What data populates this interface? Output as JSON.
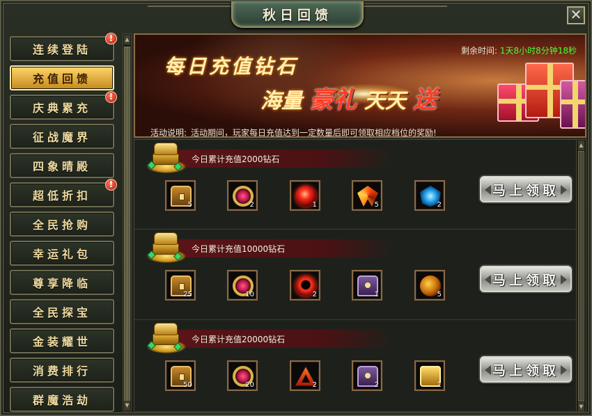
{
  "window": {
    "title": "秋日回馈",
    "close_icon": "close-icon"
  },
  "sidebar": {
    "items": [
      {
        "label": "连续登陆",
        "alert": "!"
      },
      {
        "label": "充值回馈",
        "active": true
      },
      {
        "label": "庆典累充",
        "alert": "!"
      },
      {
        "label": "征战魔界"
      },
      {
        "label": "四象晴殿"
      },
      {
        "label": "超低折扣",
        "alert": "!"
      },
      {
        "label": "全民抢购"
      },
      {
        "label": "幸运礼包"
      },
      {
        "label": "尊享降临"
      },
      {
        "label": "全民探宝"
      },
      {
        "label": "金装耀世"
      },
      {
        "label": "消费排行"
      },
      {
        "label": "群魔浩劫"
      }
    ]
  },
  "banner": {
    "line1": "每日充值钻石",
    "line2_a": "海量",
    "line2_b": "豪礼",
    "line2_c": "天天",
    "line2_d": "送",
    "remain_label": "剩余时间:",
    "remain_value": "1天8小时8分钟18秒",
    "desc_label": "活动说明:",
    "desc_text": "活动期间，玩家每日充值达到一定数量后即可领取相应档位的奖励!"
  },
  "tiers": [
    {
      "title": "今日累计充值2000钻石",
      "button": "马上领取",
      "items": [
        {
          "icon": "chest-icon",
          "qty": "5"
        },
        {
          "icon": "ruby-ring-icon",
          "qty": "2"
        },
        {
          "icon": "fire-orb-icon",
          "qty": "1"
        },
        {
          "icon": "phoenix-wing-icon",
          "qty": "5"
        },
        {
          "icon": "sapphire-icon",
          "qty": "2"
        }
      ]
    },
    {
      "title": "今日累计充值10000钻石",
      "button": "马上领取",
      "items": [
        {
          "icon": "chest-icon",
          "qty": "25"
        },
        {
          "icon": "ruby-ring-icon",
          "qty": "10"
        },
        {
          "icon": "dark-orb-icon",
          "qty": "2"
        },
        {
          "icon": "purple-chest-icon",
          "qty": "1"
        },
        {
          "icon": "dragon-icon",
          "qty": "5"
        }
      ]
    },
    {
      "title": "今日累计充值20000钻石",
      "button": "马上领取",
      "items": [
        {
          "icon": "chest-icon",
          "qty": "50"
        },
        {
          "icon": "ruby-ring-icon",
          "qty": "20"
        },
        {
          "icon": "flame-triangle-icon",
          "qty": "2"
        },
        {
          "icon": "purple-chest-icon",
          "qty": "2"
        },
        {
          "icon": "gold-chest-icon",
          "qty": "1"
        }
      ]
    }
  ]
}
